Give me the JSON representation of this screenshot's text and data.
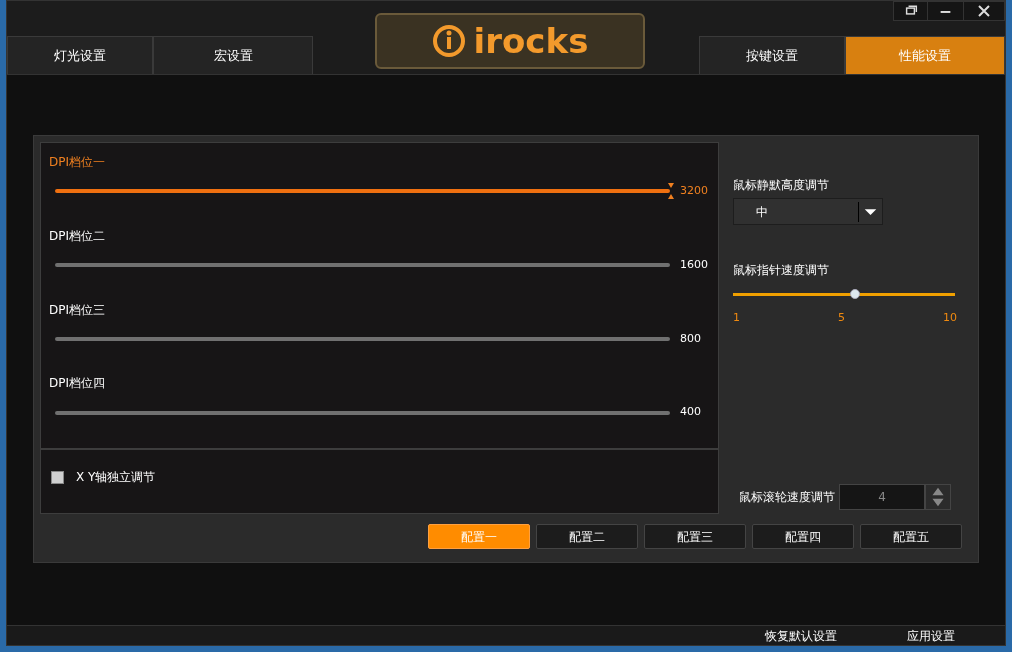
{
  "tabs": [
    {
      "label": "灯光设置",
      "selected": false
    },
    {
      "label": "宏设置",
      "selected": false
    },
    {
      "label": "按键设置",
      "selected": false
    },
    {
      "label": "性能设置",
      "selected": true
    }
  ],
  "logo": {
    "text": "irocks"
  },
  "dpi_stages": [
    {
      "label": "DPI档位一",
      "value": "3200",
      "selected": true
    },
    {
      "label": "DPI档位二",
      "value": "1600",
      "selected": false
    },
    {
      "label": "DPI档位三",
      "value": "800",
      "selected": false
    },
    {
      "label": "DPI档位四",
      "value": "400",
      "selected": false
    }
  ],
  "xy_independent": {
    "label": "X Y轴独立调节",
    "checked": false
  },
  "lift_height": {
    "label": "鼠标静默高度调节",
    "value": "中"
  },
  "pointer_speed": {
    "label": "鼠标指针速度调节",
    "level": 0.55,
    "ticks": [
      "1",
      "5",
      "10"
    ]
  },
  "scroll_speed": {
    "label": "鼠标滚轮速度调节",
    "value": "4"
  },
  "profiles": [
    {
      "label": "配置一",
      "selected": true
    },
    {
      "label": "配置二",
      "selected": false
    },
    {
      "label": "配置三",
      "selected": false
    },
    {
      "label": "配置四",
      "selected": false
    },
    {
      "label": "配置五",
      "selected": false
    }
  ],
  "footer_buttons": [
    "恢复默认设置",
    "应用设置"
  ]
}
